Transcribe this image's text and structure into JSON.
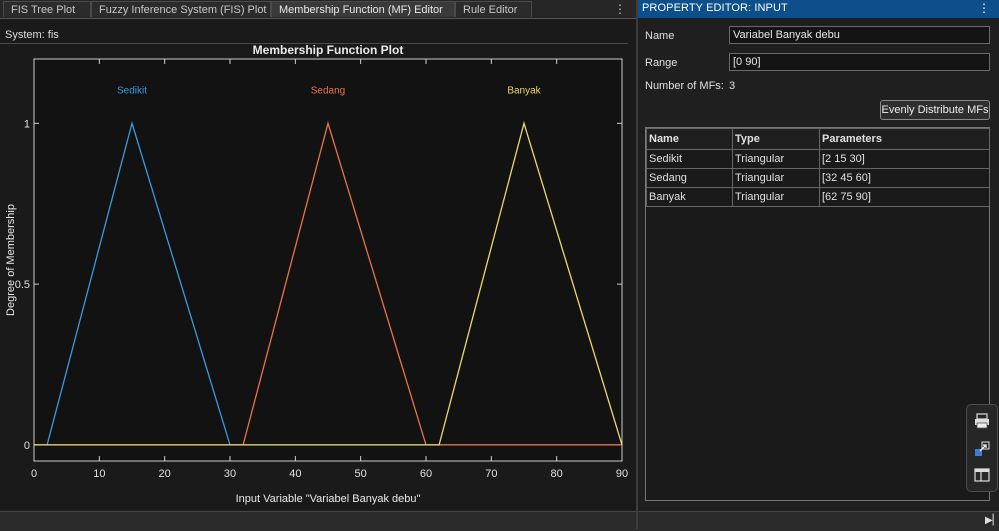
{
  "tabs": [
    {
      "label": "FIS Tree Plot"
    },
    {
      "label": "Fuzzy Inference System (FIS) Plot"
    },
    {
      "label": "Membership Function (MF) Editor"
    },
    {
      "label": "Rule Editor"
    }
  ],
  "tab_menu_icon": "vertical-ellipsis-icon",
  "system_label": "System: fis",
  "plot": {
    "title": "Membership Function Plot",
    "xlabel": "Input Variable \"Variabel Banyak debu\"",
    "ylabel": "Degree of Membership"
  },
  "chart_data": {
    "type": "line",
    "title": "Membership Function Plot",
    "xlabel": "Input Variable \"Variabel Banyak debu\"",
    "ylabel": "Degree of Membership",
    "xlim": [
      0,
      90
    ],
    "ylim": [
      -0.05,
      1.2
    ],
    "xticks": [
      0,
      10,
      20,
      30,
      40,
      50,
      60,
      70,
      80,
      90
    ],
    "yticks": [
      0,
      0.5,
      1
    ],
    "xtick_labels": [
      "0",
      "10",
      "20",
      "30",
      "40",
      "50",
      "60",
      "70",
      "80",
      "90"
    ],
    "ytick_labels": [
      "0",
      "0.5",
      "1"
    ],
    "grid": false,
    "series": [
      {
        "name": "Sedikit",
        "color": "#3a9bdc",
        "x": [
          0,
          2,
          15,
          30,
          90
        ],
        "y": [
          0,
          0,
          1,
          0,
          0
        ]
      },
      {
        "name": "Sedang",
        "color": "#e8734a",
        "x": [
          0,
          32,
          45,
          60,
          90
        ],
        "y": [
          0,
          0,
          1,
          0,
          0
        ]
      },
      {
        "name": "Banyak",
        "color": "#ead96a",
        "x": [
          0,
          62,
          75,
          90,
          90
        ],
        "y": [
          0,
          0,
          1,
          0,
          0
        ]
      }
    ]
  },
  "property_editor": {
    "header": "PROPERTY EDITOR: INPUT",
    "menu_icon": "vertical-ellipsis-icon",
    "name_label": "Name",
    "name_value": "Variabel Banyak debu",
    "range_label": "Range",
    "range_value": "[0 90]",
    "num_mfs_label": "Number of MFs:",
    "num_mfs_value": "3",
    "distribute_button": "Evenly Distribute MFs",
    "table": {
      "headers": [
        "Name",
        "Type",
        "Parameters"
      ],
      "rows": [
        [
          "Sedikit",
          "Triangular",
          "[2 15 30]"
        ],
        [
          "Sedang",
          "Triangular",
          "[32 45 60]"
        ],
        [
          "Banyak",
          "Triangular",
          "[62 75 90]"
        ]
      ]
    }
  },
  "toolstrip_icons": [
    "save-figure-icon",
    "open-in-figure-icon",
    "layout-icon"
  ],
  "colors": {
    "accent": "#0c4f8a",
    "sedikit": "#3a9bdc",
    "sedang": "#e8734a",
    "banyak": "#ead96a"
  }
}
